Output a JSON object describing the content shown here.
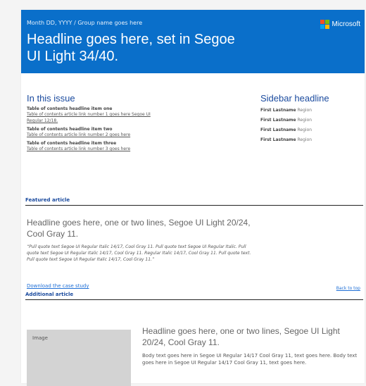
{
  "header": {
    "dateline": "Month DD, YYYY / Group name goes here",
    "headline": "Headline goes here, set in Segoe UI Light 34/40.",
    "logo_text": "Microsoft",
    "logo_colors": [
      "#f25022",
      "#7fba00",
      "#00a4ef",
      "#ffb900"
    ],
    "background": "#0a6fca"
  },
  "toc": {
    "title": "In this issue",
    "items": [
      {
        "heading": "Table of contents headline item one",
        "link": "Table of contents article link number 1 goes here Segoe UI Regular 12/18."
      },
      {
        "heading": "Table of contents headline item two",
        "link": "Table of contents article link number 2 goes here"
      },
      {
        "heading": "Table of contents headline item three",
        "link": "Table of contents article link number 3 goes here"
      }
    ]
  },
  "sidebar": {
    "title": "Sidebar headline",
    "people": [
      {
        "name": "First Lastname",
        "region": "Region"
      },
      {
        "name": "First Lastname",
        "region": "Region"
      },
      {
        "name": "First Lastname",
        "region": "Region"
      },
      {
        "name": "First Lastname",
        "region": "Region"
      }
    ]
  },
  "featured": {
    "label": "Featured article",
    "headline": "Headline goes here, one or two lines, Segoe UI Light 20/24, Cool Gray 11.",
    "quote": "“Pull quote text Segoe UI Regular Italic 14/17, Cool Gray 11. Pull quote text Segoe UI Regular Italic. Pull quote text Segoe UI Regular Italic 14/17, Cool Gray 11. Regular Italic 14/17, Cool Gray 11. Pull quote text. Pull quote text Segoe UI Regular Italic 14/17, Cool Gray 11.”",
    "download_link": "Download the case study",
    "back_to_top": "Back to top"
  },
  "additional": {
    "label": "Additional article",
    "image_label": "Image",
    "headline": "Headline goes here, one or two lines, Segoe UI Light 20/24, Cool Gray 11.",
    "body": "Body text goes here in Segoe UI Regular 14/17 Cool Gray 11, text goes here. Body text goes here in Segoe UI Regular 14/17 Cool Gray 11, text goes here."
  }
}
